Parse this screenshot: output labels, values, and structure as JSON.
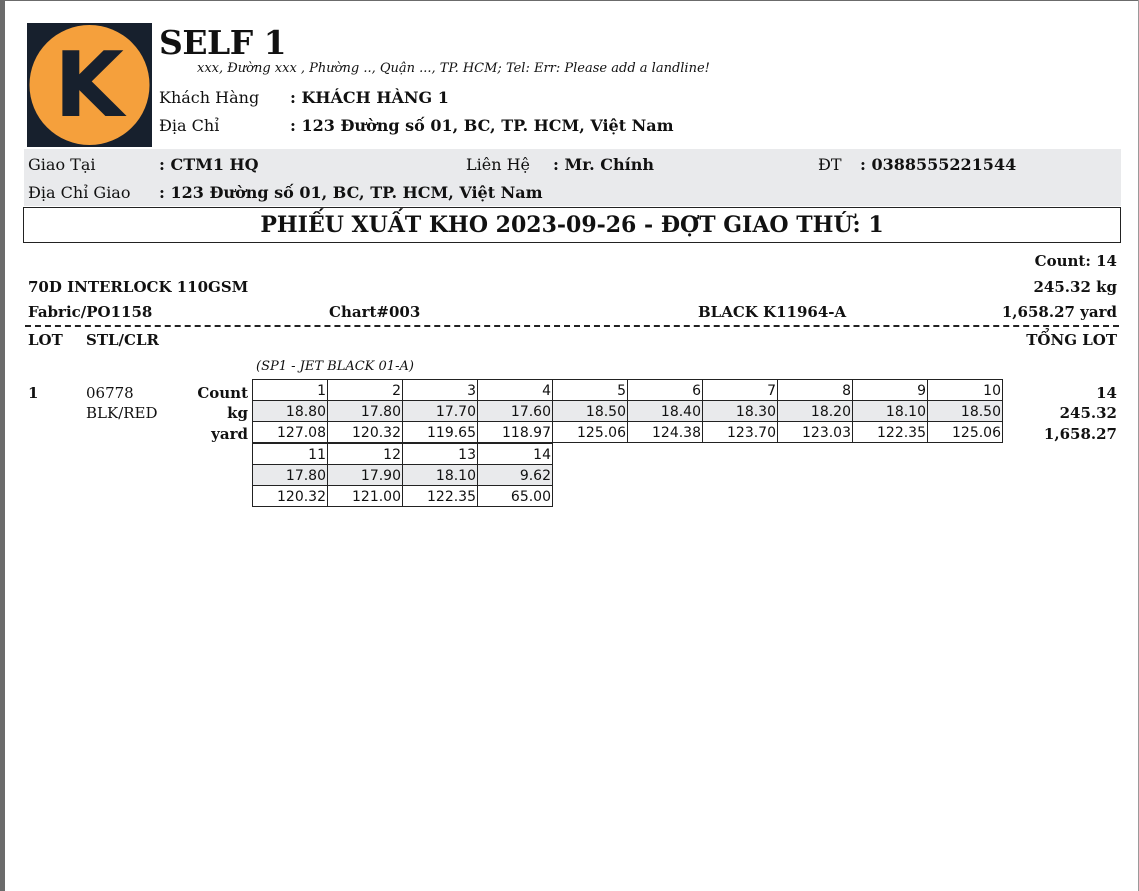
{
  "company": {
    "name": "SELF 1",
    "logo_letter": "K",
    "address": "xxx, Đường xxx , Phường .., Quận ..., TP. HCM; Tel: Err: Please add a landline!"
  },
  "customer": {
    "name_label": "Khách Hàng",
    "name_value": ": KHÁCH HÀNG 1",
    "address_label": "Địa Chỉ",
    "address_value": ": 123 Đường số 01, BC, TP. HCM, Việt Nam"
  },
  "delivery": {
    "at_label": "Giao Tại",
    "at_value": ": CTM1 HQ",
    "contact_label": "Liên Hệ",
    "contact_value": ": Mr. Chính",
    "phone_label": "ĐT",
    "phone_value": ": 0388555221544",
    "address_label": "Địa Chỉ Giao",
    "address_value": ": 123 Đường số 01, BC, TP. HCM, Việt Nam"
  },
  "title": "PHIẾU XUẤT KHO 2023-09-26 - ĐỢT GIAO THỨ: 1",
  "summary": {
    "count": "Count: 14",
    "fabric_name": "70D INTERLOCK 110GSM",
    "total_kg": "245.32 kg",
    "po": "Fabric/PO1158",
    "chart": "Chart#003",
    "color": "BLACK K11964-A",
    "total_yard": "1,658.27 yard"
  },
  "headers": {
    "lot": "LOT",
    "stl_clr": "STL/CLR",
    "total_lot": "TỔNG LOT"
  },
  "lot": {
    "number": "1",
    "style": "06778",
    "color": "BLK/RED",
    "subtitle": "(SP1 - JET BLACK 01-A)",
    "row_labels": {
      "count": "Count",
      "kg": "kg",
      "yard": "yard"
    },
    "rolls_1": {
      "count": [
        "1",
        "2",
        "3",
        "4",
        "5",
        "6",
        "7",
        "8",
        "9",
        "10"
      ],
      "kg": [
        "18.80",
        "17.80",
        "17.70",
        "17.60",
        "18.50",
        "18.40",
        "18.30",
        "18.20",
        "18.10",
        "18.50"
      ],
      "yard": [
        "127.08",
        "120.32",
        "119.65",
        "118.97",
        "125.06",
        "124.38",
        "123.70",
        "123.03",
        "122.35",
        "125.06"
      ]
    },
    "rolls_2": {
      "count": [
        "11",
        "12",
        "13",
        "14"
      ],
      "kg": [
        "17.80",
        "17.90",
        "18.10",
        "9.62"
      ],
      "yard": [
        "120.32",
        "121.00",
        "122.35",
        "65.00"
      ]
    },
    "totals": {
      "count": "14",
      "kg": "245.32",
      "yard": "1,658.27"
    }
  },
  "colors": {
    "logo_bg": "#17202d",
    "logo_circle": "#f5a03c",
    "band": "#e9eaec"
  }
}
